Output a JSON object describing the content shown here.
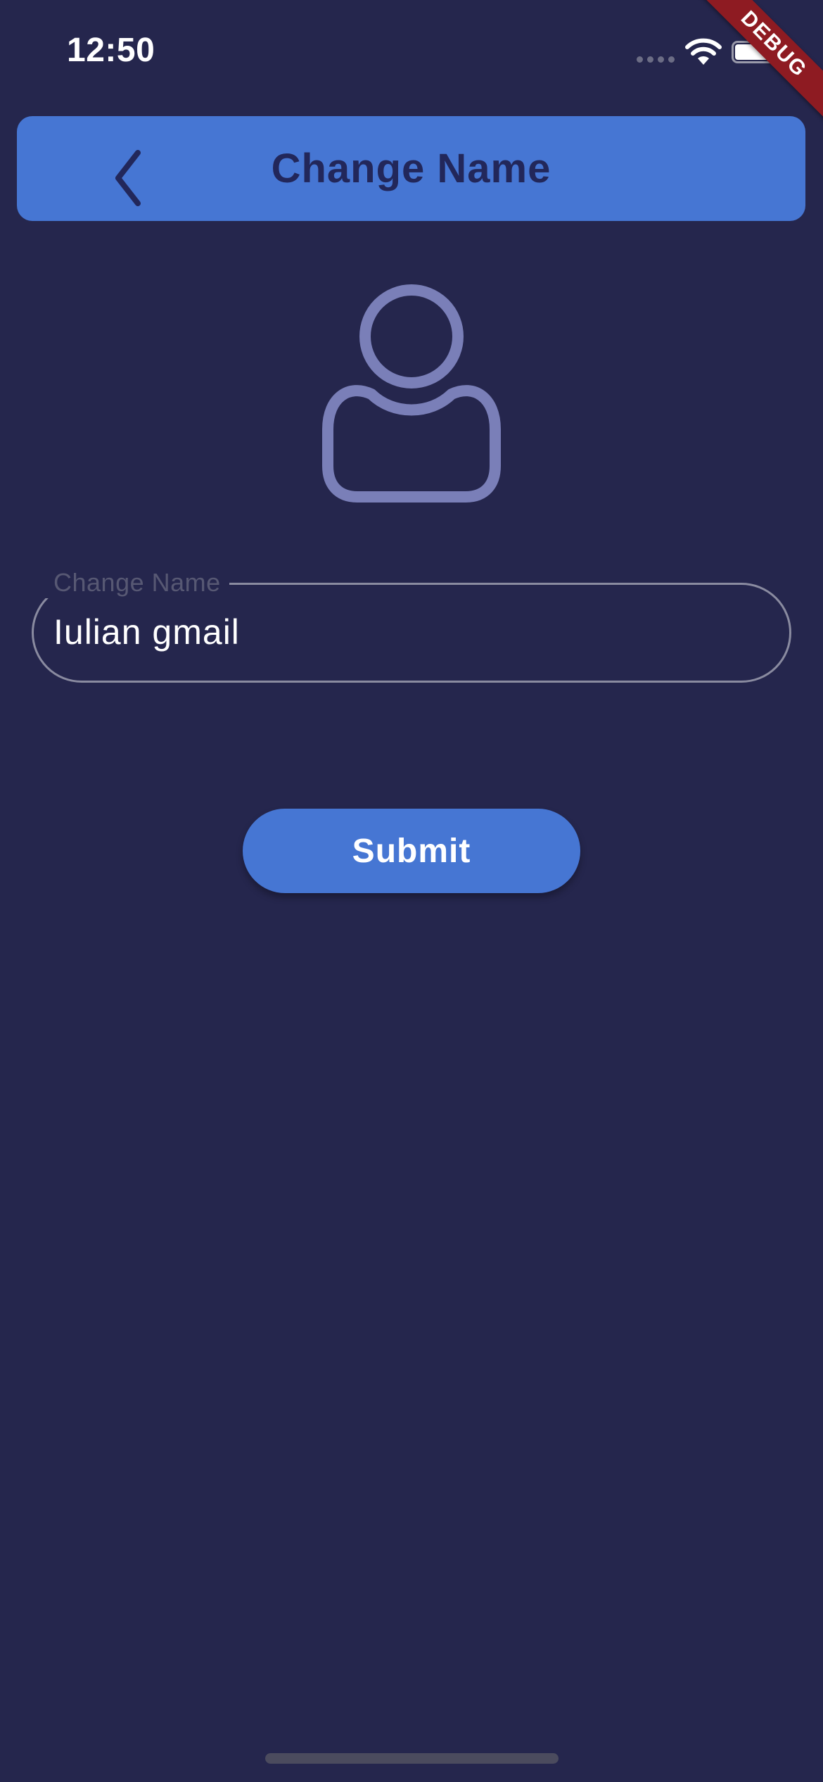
{
  "status_bar": {
    "time": "12:50"
  },
  "debug_banner": "DEBUG",
  "app_bar": {
    "title": "Change Name",
    "back_icon": "chevron-left-icon"
  },
  "avatar": {
    "icon": "user-outline-icon"
  },
  "name_field": {
    "label": "Change Name",
    "value": "Iulian gmail"
  },
  "submit_button": {
    "label": "Submit"
  },
  "colors": {
    "background": "#25264d",
    "accent": "#4676d3",
    "title_text": "#22275a",
    "avatar_stroke": "#7a7fb8",
    "field_border": "#8a8ba0",
    "debug_ribbon": "#8e1b22"
  }
}
